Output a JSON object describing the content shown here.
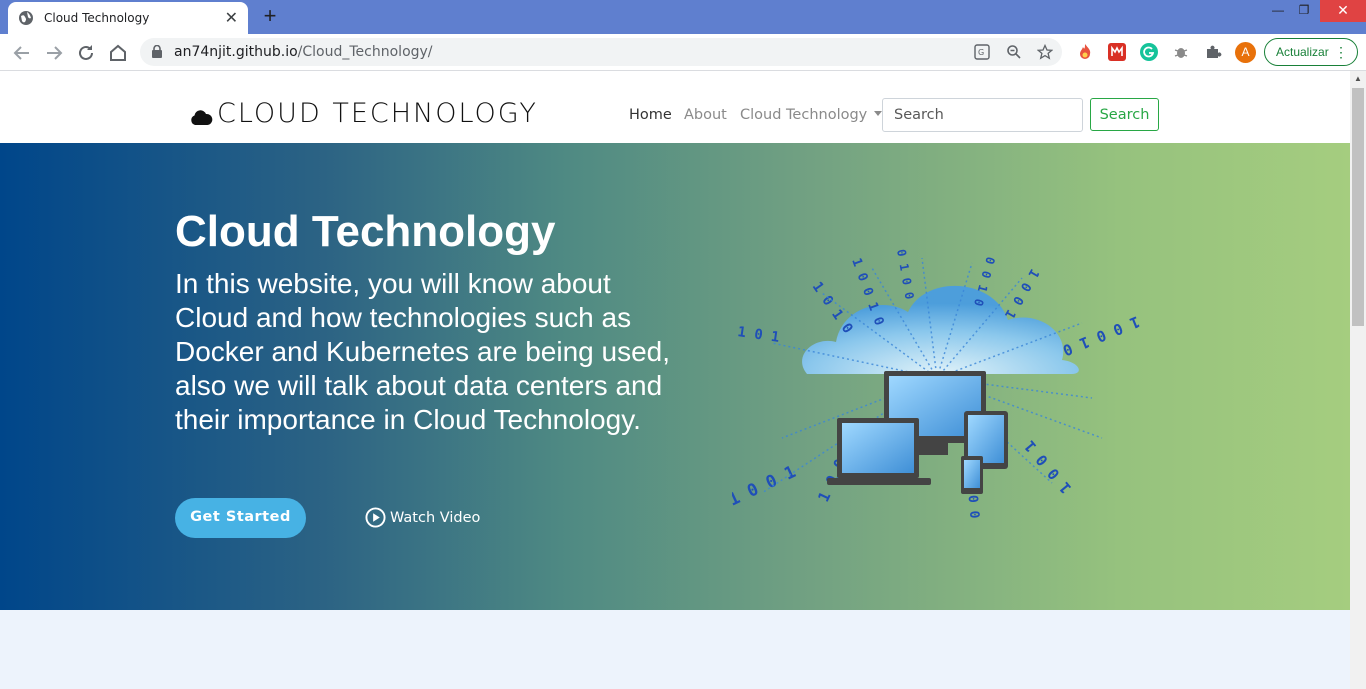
{
  "browser": {
    "tab_title": "Cloud Technology",
    "tab_close": "✕",
    "new_tab": "+",
    "url_host": "an74njit.github.io",
    "url_path": "/Cloud_Technology/",
    "update_button": "Actualizar",
    "avatar_letter": "A",
    "window_close": "✕"
  },
  "nav": {
    "brand": "CLOUD TECHNOLOGY",
    "links": [
      {
        "label": "Home"
      },
      {
        "label": "About"
      },
      {
        "label": "Cloud Technology"
      }
    ],
    "search_placeholder": "Search",
    "search_button": "Search"
  },
  "hero": {
    "title": "Cloud Technology",
    "text": "In this website, you will know about Cloud and how technologies such as Docker and Kubernetes are being used, also we will talk about data centers and their importance in Cloud Technology.",
    "get_started": "Get Started",
    "watch_video": "Watch Video"
  },
  "colors": {
    "tabbar": "#5f7fcf",
    "hero_start": "#00468a",
    "hero_end": "#a5cd7f",
    "button_blue": "#47b2e4",
    "search_green": "#28a745",
    "page_bg": "#edf3fc"
  }
}
